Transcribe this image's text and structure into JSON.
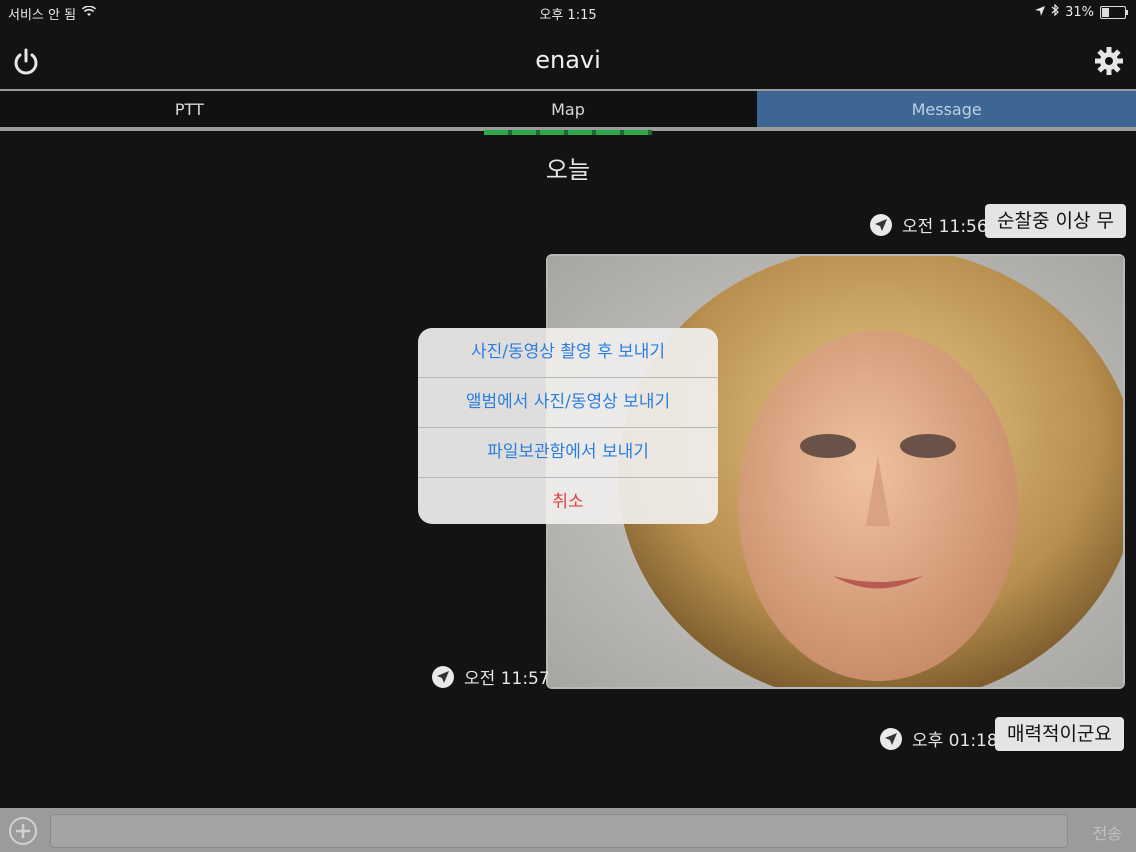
{
  "status": {
    "carrier": "서비스 안 됨",
    "time": "오후 1:15",
    "battery_text": "31%",
    "battery_level": 0.31
  },
  "navbar": {
    "title": "enavi"
  },
  "tabs": [
    {
      "label": "PTT"
    },
    {
      "label": "Map"
    },
    {
      "label": "Message"
    }
  ],
  "chat": {
    "day_label": "오늘",
    "messages": [
      {
        "time": "오전 11:56",
        "text": "순찰중 이상 무"
      },
      {
        "time": "오전 11:57"
      },
      {
        "time": "오후 01:18",
        "text": "매력적이군요"
      }
    ]
  },
  "action_sheet": {
    "items": [
      "사진/동영상 촬영 후 보내기",
      "앨범에서 사진/동영상 보내기",
      "파일보관함에서 보내기",
      "취소"
    ]
  },
  "composer": {
    "send_label": "전송"
  }
}
